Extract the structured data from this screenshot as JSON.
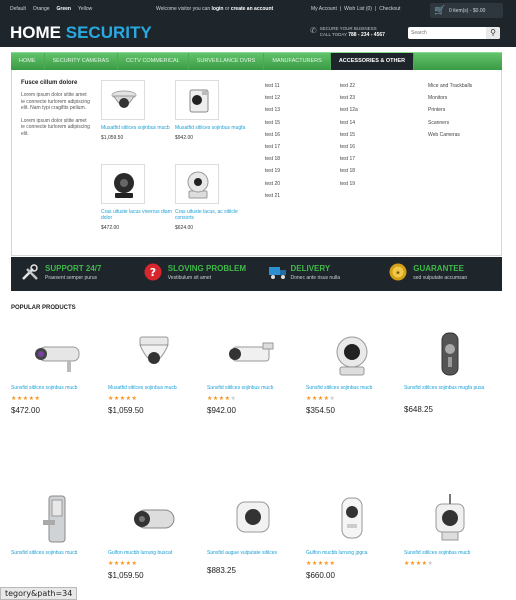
{
  "topbar": {
    "themes": [
      "Default",
      "Orange",
      "Green",
      "Yellow"
    ],
    "active_theme": "Green",
    "welcome_prefix": "Welcome visitor you can",
    "login": "login",
    "or": "or",
    "create_account": "create an account",
    "account_links": [
      "My Account",
      "|",
      "Wish List (0)",
      "|",
      "Checkout"
    ],
    "cart_text": "0 item(s) - $0.00"
  },
  "header": {
    "logo_part1": "HOME",
    "logo_part2": "SECURITY",
    "phone_label": "SECURE YOUR BUSINESS",
    "phone_call": "CALL TODAY",
    "phone_number": "788 - 234 - 4567",
    "search_placeholder": "Search"
  },
  "nav": {
    "items": [
      "Home",
      "Security Cameras",
      "CCTV Commerical",
      "Surveillance DVRs",
      "Manufacturers",
      "Accessories & Other"
    ],
    "active": "Accessories & Other"
  },
  "mega": {
    "title": "Fusce cillum dolore",
    "para1": "Lorem ipsum dolor sitite amet ie connecte turlorem adipiscing elit. Nam typi cragifits pellum.",
    "para2": "Lorem ipsum dolor sitite amet ie connecte turlorem adipiscing elit.",
    "products": [
      {
        "name": "Musatfid sitilces sojinbus mucb",
        "price": "$1,059.50"
      },
      {
        "name": "Musatfid sitilces sojinbus mugfa",
        "price": "$942.00"
      },
      {
        "name": "Cras ultuste lacus viverrus diam dolor",
        "price": "$472.00"
      },
      {
        "name": "Cras ultuste lacus, ac sitilcle consorts",
        "price": "$624.00"
      }
    ],
    "links_col1": [
      "test 11",
      "test 12",
      "test 13",
      "test 15",
      "test 16",
      "test 17",
      "test 18",
      "test 19",
      "test 20",
      "test 21"
    ],
    "links_col2": [
      "test 22",
      "test 23",
      "test 12a",
      "test 14",
      "test 15",
      "test 16",
      "test 17",
      "test 18",
      "test 19"
    ],
    "links_col3": [
      "Mice and Trackballs",
      "Monitors",
      "Printers",
      "Scanners",
      "Web Cameras"
    ]
  },
  "features": [
    {
      "title": "Support 24/7",
      "sub": "Praesent semper purus",
      "icon": "tools-icon"
    },
    {
      "title": "Sloving Problem",
      "sub": "Vestibulum sit amet",
      "icon": "question-icon"
    },
    {
      "title": "Delivery",
      "sub": "Donec ante risus nulla",
      "icon": "truck-icon"
    },
    {
      "title": "Guarantee",
      "sub": "sed vulputate accumsan",
      "icon": "medal-icon"
    }
  ],
  "popular": {
    "title": "POPULAR PRODUCTS",
    "row1": [
      {
        "name": "Sunsfid sitilces sojinbus mucb",
        "rating": 5,
        "price": "$472.00"
      },
      {
        "name": "Musatfid sitilces sojinbus mucb",
        "rating": 5,
        "price": "$1,059.50"
      },
      {
        "name": "Sunsfid sitilces sojinbus mucb",
        "rating": 4,
        "price": "$942.00"
      },
      {
        "name": "Sunsfid sitilces sojinbus mucb",
        "rating": 4,
        "price": "$354.50"
      },
      {
        "name": "Sunsfid sitilces sojinbus mugfa pusa",
        "rating": 0,
        "price": "$648.25"
      }
    ],
    "row2": [
      {
        "name": "Sunsfid sitilces sojinbus mucb",
        "rating": 0,
        "price": ""
      },
      {
        "name": "Gulfon mucbb lurrung buscat",
        "rating": 5,
        "price": "$1,059.50"
      },
      {
        "name": "Sunsfid augue vulputate sitilces",
        "rating": 0,
        "price": "$883.25"
      },
      {
        "name": "Gulfon mucbb lurrung jpgca",
        "rating": 5,
        "price": "$660.00"
      },
      {
        "name": "Sunsfid sitilces sojinbus mucb",
        "rating": 4,
        "price": ""
      }
    ]
  },
  "statusbar": "tegory&path=34"
}
